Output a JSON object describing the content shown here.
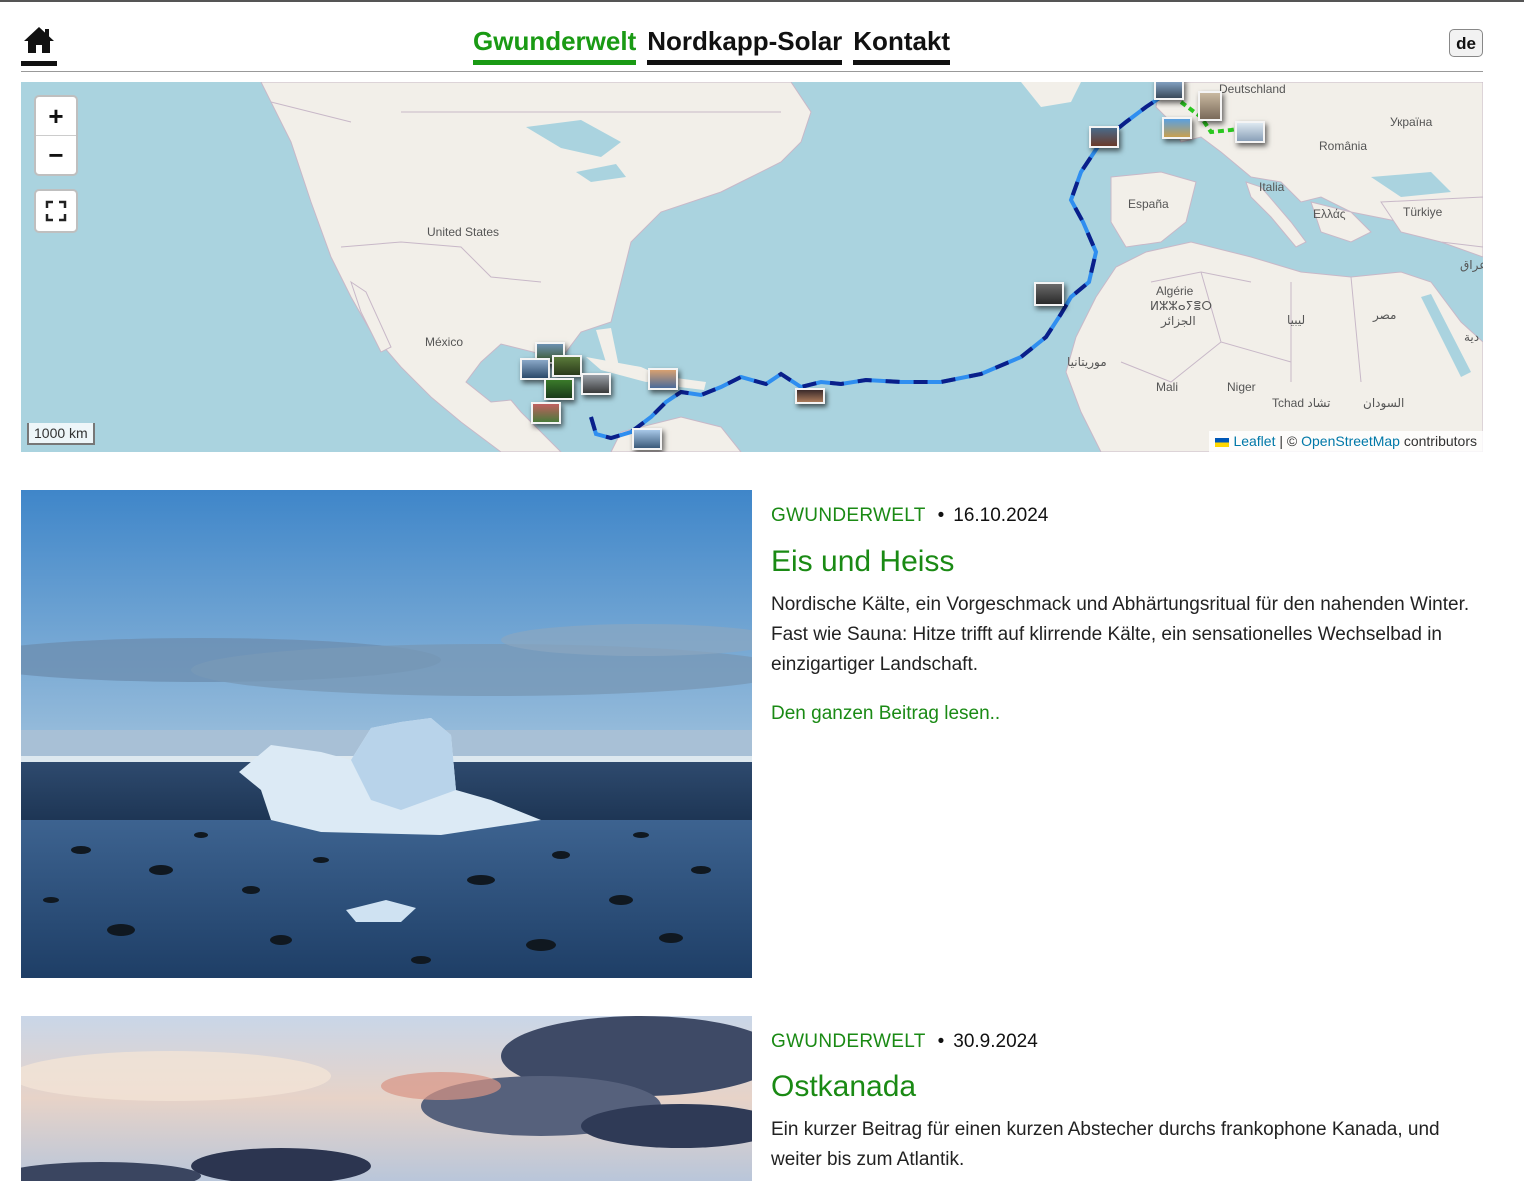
{
  "header": {
    "home_icon": "home-icon",
    "nav": [
      {
        "label": "Gwunderwelt",
        "active": true
      },
      {
        "label": "Nordkapp-Solar",
        "active": false
      },
      {
        "label": "Kontakt",
        "active": false
      }
    ],
    "lang": "de"
  },
  "map": {
    "zoom_in": "+",
    "zoom_out": "−",
    "fullscreen_icon": "fullscreen-icon",
    "scale": "1000 km",
    "attribution": {
      "leaflet": "Leaflet",
      "separator": "| ©",
      "osm": "OpenStreetMap",
      "suffix": "contributors"
    },
    "labels": {
      "united_states": "United States",
      "mexico": "México",
      "deutschland": "Deutschland",
      "ukraina": "Україна",
      "romania": "România",
      "italia": "Italia",
      "espana": "España",
      "ellas": "Ελλάς",
      "turkiye": "Türkiye",
      "iraq": "عراق",
      "algerie": "Algérie",
      "algerie_tifinagh": "ⵍⵣⵣⴰⵢⴻⵔ",
      "algerie_ar": "الجزائر",
      "libya": "ليبيا",
      "egypt": "مصر",
      "saudi": "دية",
      "mauritania": "موريتانيا",
      "mali": "Mali",
      "niger": "Niger",
      "tchad": "Tchad تشاد",
      "sudan": "السودان"
    }
  },
  "posts": [
    {
      "category": "GWUNDERWELT",
      "date": "16.10.2024",
      "title": "Eis und Heiss",
      "excerpt": "Nordische Kälte, ein Vorgeschmack und Abhärtungsritual für den nahenden Winter. Fast wie Sauna: Hitze trifft auf klirrende Kälte, ein sensationelles Wechselbad in einzigartiger Landschaft.",
      "read_more": "Den ganzen Beitrag lesen.."
    },
    {
      "category": "GWUNDERWELT",
      "date": "30.9.2024",
      "title": "Ostkanada",
      "excerpt": "Ein kurzer Beitrag für einen kurzen Abstecher durchs frankophone Kanada, und weiter bis zum Atlantik."
    }
  ]
}
